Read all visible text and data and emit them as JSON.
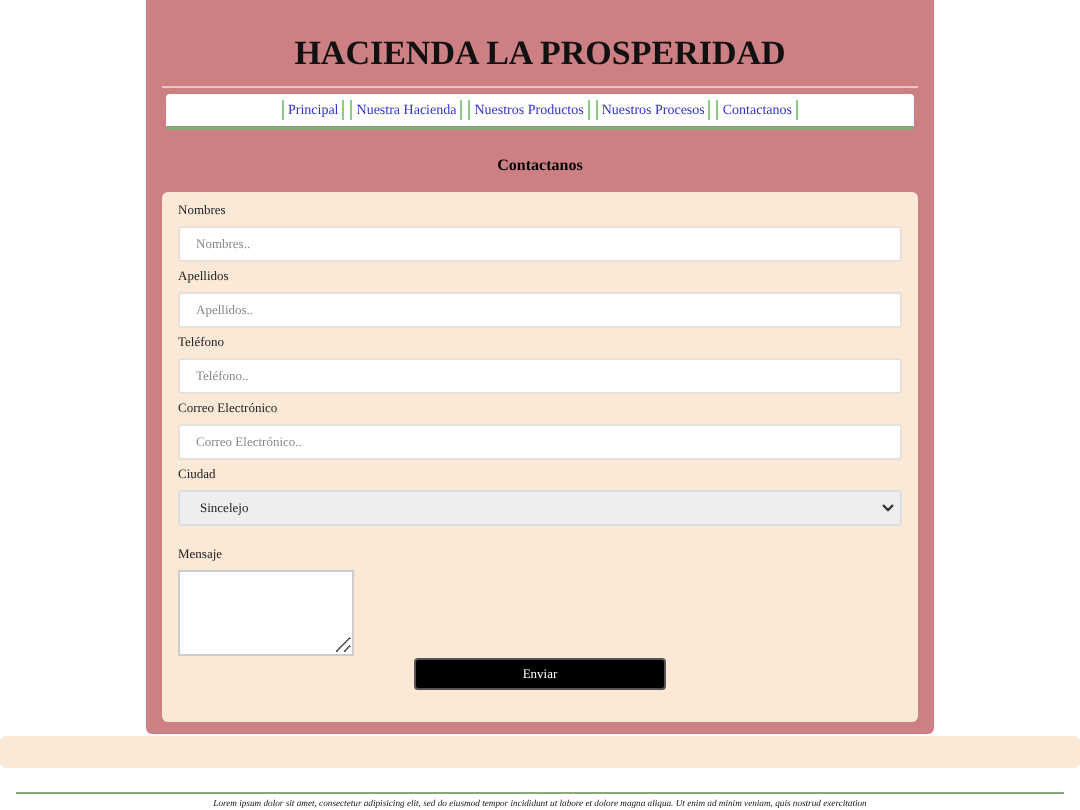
{
  "header": {
    "title": "HACIENDA LA PROSPERIDAD"
  },
  "nav": [
    {
      "label": "Principal"
    },
    {
      "label": "Nuestra Hacienda"
    },
    {
      "label": "Nuestros Productos"
    },
    {
      "label": "Nuestros Procesos"
    },
    {
      "label": "Contactanos"
    }
  ],
  "section_title": "Contactanos",
  "form": {
    "fields": [
      {
        "kind": "text",
        "label": "Nombres",
        "placeholder": "Nombres.."
      },
      {
        "kind": "text",
        "label": "Apellidos",
        "placeholder": "Apellidos.."
      },
      {
        "kind": "text",
        "label": "Teléfono",
        "placeholder": "Teléfono.."
      },
      {
        "kind": "text",
        "label": "Correo Electrónico",
        "placeholder": "Correo Electrónico.."
      },
      {
        "kind": "select",
        "label": "Ciudad",
        "value": "Sincelejo"
      },
      {
        "kind": "textarea",
        "label": "Mensaje"
      }
    ],
    "submit": "Enviar"
  },
  "footer": {
    "text": "Lorem ipsum dolor sit amet, consectetur adipisicing elit, sed do eiusmod tempor incididunt ut labore et dolore magna aliqua. Ut enim ad minim veniam, quis nostrud exercitation"
  }
}
